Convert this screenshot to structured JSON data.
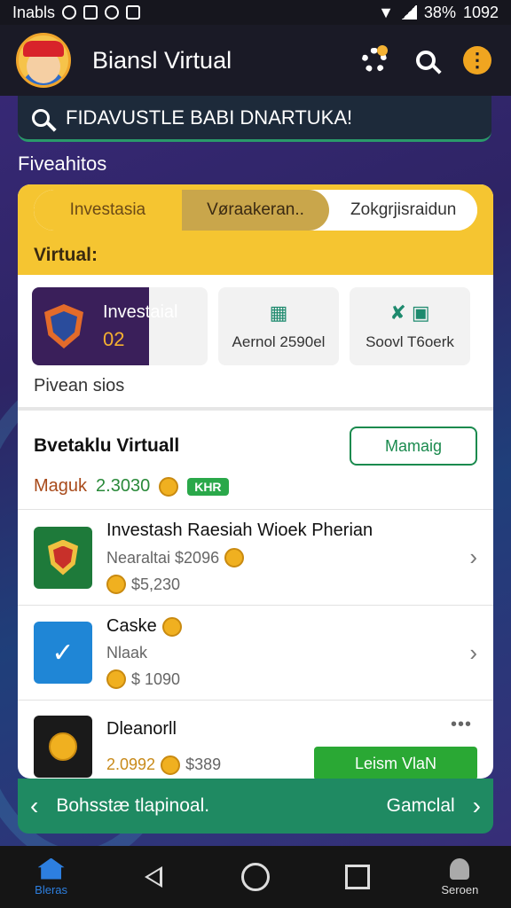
{
  "status_bar": {
    "carrier": "Inabls",
    "battery": "38%",
    "time": "1092"
  },
  "header": {
    "title": "Biansl Virtual"
  },
  "search": {
    "text": "FIDAVUSTLE BABI DNARTUKA!"
  },
  "section_label": "Fiveahitos",
  "tabs": [
    {
      "label": "Investasia"
    },
    {
      "label": "Vøraakeran.."
    },
    {
      "label": "Zokgrjisraidun"
    }
  ],
  "virtual_label": "Virtual:",
  "tiles": {
    "tile1": {
      "title": "Investaial",
      "value": "02"
    },
    "tile2": {
      "label": "Aernol 2590el"
    },
    "tile3": {
      "label": "Soovl T6oerk"
    }
  },
  "previews_label": "Pivean sios",
  "list_section": {
    "title": "Bvetaklu Virtuall",
    "manage_label": "Mamaig",
    "magic_label": "Maguk",
    "magic_value": "2.3030",
    "magic_pill": "KHR"
  },
  "items": [
    {
      "title": "Investash Raesiah Wioek Pherian",
      "sub1": "Nearaltai $2096",
      "sub2": "$5,230"
    },
    {
      "title": "Caske",
      "sub1": "Nlaak",
      "sub2": "$ 1090"
    },
    {
      "title": "Dleanorll",
      "value": "2.0992",
      "price": "$389",
      "button": "Leism VlaN"
    }
  ],
  "banner": {
    "left": "Bohsstæ tlapinoal.",
    "right": "Gamclal"
  },
  "nav": {
    "home": "Bleras",
    "settings": "Seroen"
  }
}
